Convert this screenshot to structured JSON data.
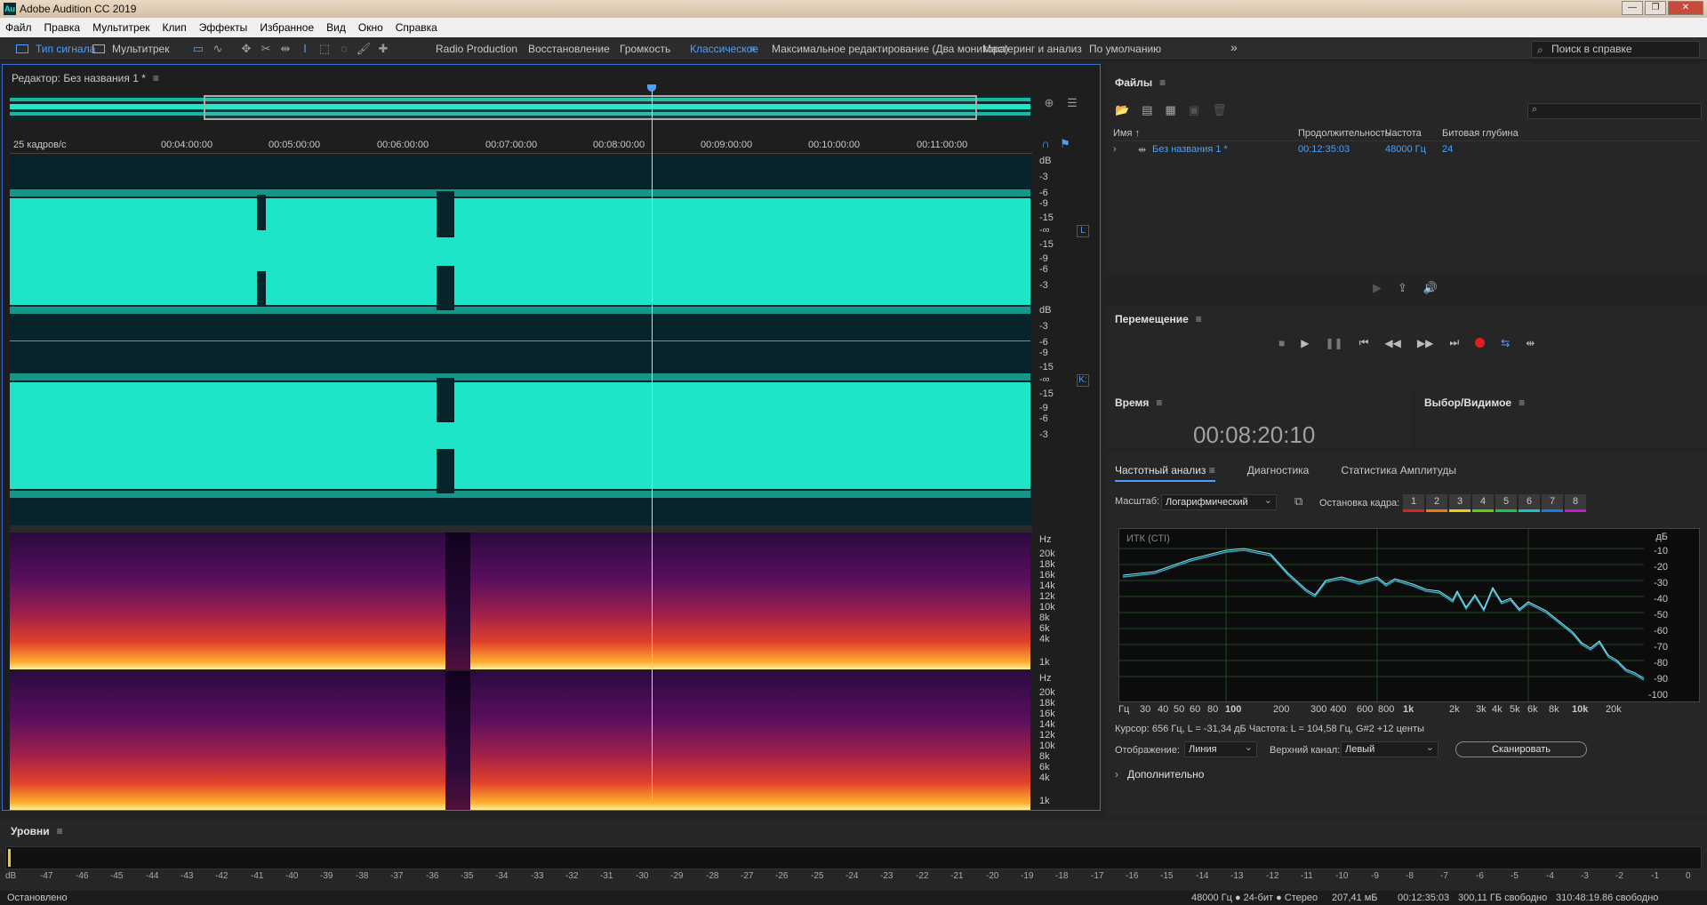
{
  "window": {
    "title": "Adobe Audition CC 2019",
    "logo": "Au",
    "min": "—",
    "max": "❐",
    "close": "✕"
  },
  "menu": [
    "Файл",
    "Правка",
    "Мультитрек",
    "Клип",
    "Эффекты",
    "Избранное",
    "Вид",
    "Окно",
    "Справка"
  ],
  "toolbar": {
    "mode_waveform": "Тип сигнала",
    "mode_multitrack": "Мультитрек",
    "workspaces": [
      "Radio Production",
      "Восстановление",
      "Громкость",
      "Классическое",
      "Максимальное редактирование (Два монитора)",
      "Мастеринг и анализ",
      "По умолчанию"
    ],
    "active_workspace": "Классическое",
    "more": "»",
    "help_placeholder": "Поиск в справке"
  },
  "editor": {
    "title": "Редактор: Без названия 1 *",
    "menu_icon": "≡",
    "fps": "25 кадров/с",
    "ruler": [
      "00:04:00:00",
      "00:05:00:00",
      "00:06:00:00",
      "00:07:00:00",
      "00:08:00:00",
      "00:09:00:00",
      "00:10:00:00",
      "00:11:00:00"
    ],
    "db_ch1": [
      "dB",
      "-3",
      "-6",
      "-9",
      "-15",
      "-∞",
      "-15",
      "-9",
      "-6",
      "-3"
    ],
    "db_ch2": [
      "dB",
      "-3",
      "-6",
      "-9",
      "-15",
      "-∞",
      "-15",
      "-9",
      "-6",
      "-3"
    ],
    "ch1_label": "L",
    "ch2_label": "K:",
    "hz_ch1": [
      "Hz",
      "20k",
      "18k",
      "16k",
      "14k",
      "12k",
      "10k",
      "8k",
      "6k",
      "4k",
      "1k"
    ],
    "hz_ch2": [
      "Hz",
      "20k",
      "18k",
      "16k",
      "14k",
      "12k",
      "10k",
      "8k",
      "6k",
      "4k",
      "1k"
    ]
  },
  "files": {
    "title": "Файлы",
    "cols": [
      "Имя ↑",
      "Продолжительность",
      "Частота",
      "Битовая глубина"
    ],
    "rows": [
      {
        "expand": "›",
        "name": "Без названия 1 *",
        "duration": "00:12:35:03",
        "rate": "48000 Гц",
        "depth": "24"
      }
    ]
  },
  "transport": {
    "title": "Перемещение"
  },
  "time": {
    "title": "Время",
    "value": "00:08:20:10"
  },
  "selection": {
    "title": "Выбор/Видимое"
  },
  "freq": {
    "tabs": [
      "Частотный анализ",
      "Диагностика",
      "Статистика Амплитуды"
    ],
    "scale_label": "Масштаб:",
    "scale_value": "Логарифмический",
    "hold_label": "Остановка кадра:",
    "frames": [
      {
        "n": "1",
        "c": "#e02020"
      },
      {
        "n": "2",
        "c": "#f07a10"
      },
      {
        "n": "3",
        "c": "#e8d010"
      },
      {
        "n": "4",
        "c": "#60d010"
      },
      {
        "n": "5",
        "c": "#18c850"
      },
      {
        "n": "6",
        "c": "#10c8c8"
      },
      {
        "n": "7",
        "c": "#1878e8"
      },
      {
        "n": "8",
        "c": "#c818d0"
      }
    ],
    "graph_label": "ИТК (СТI)",
    "x_axis": [
      "Гц",
      "30",
      "40",
      "50",
      "60",
      "80",
      "100",
      "200",
      "300",
      "400",
      "600",
      "800",
      "1k",
      "2k",
      "3k",
      "4k",
      "5k",
      "6k",
      "8k",
      "10k",
      "20k"
    ],
    "y_axis": [
      "дБ",
      "-10",
      "-20",
      "-30",
      "-40",
      "-50",
      "-60",
      "-70",
      "-80",
      "-90",
      "-100"
    ],
    "cursor": "Курсор: 656 Гц, L = -31,34 дБ  Частота: L = 104,58 Гц, G#2 +12 центы",
    "display_label": "Отображение:",
    "display_value": "Линия",
    "channel_label": "Верхний канал:",
    "channel_value": "Левый",
    "scan": "Сканировать",
    "more": "Дополнительно"
  },
  "levels": {
    "title": "Уровни",
    "scale": [
      "dB",
      "-47",
      "-46",
      "-45",
      "-44",
      "-43",
      "-42",
      "-41",
      "-40",
      "-39",
      "-38",
      "-37",
      "-36",
      "-35",
      "-34",
      "-33",
      "-32",
      "-31",
      "-30",
      "-29",
      "-28",
      "-27",
      "-26",
      "-25",
      "-24",
      "-23",
      "-22",
      "-21",
      "-20",
      "-19",
      "-18",
      "-17",
      "-16",
      "-15",
      "-14",
      "-13",
      "-12",
      "-11",
      "-10",
      "-9",
      "-8",
      "-7",
      "-6",
      "-5",
      "-4",
      "-3",
      "-2",
      "-1",
      "0"
    ]
  },
  "status": {
    "left": "Остановлено",
    "format": "48000 Гц ● 24-бит ● Стерео",
    "size": "207,41 мБ",
    "duration": "00:12:35:03",
    "free": "300,11 ГБ свободно",
    "free_time": "310:48:19.86 свободно"
  }
}
